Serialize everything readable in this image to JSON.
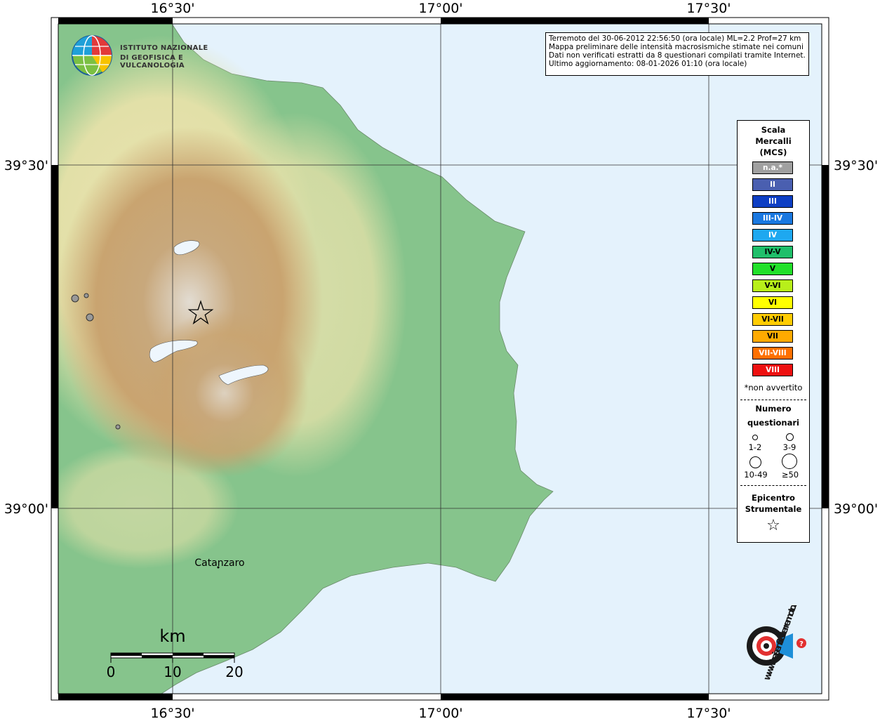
{
  "axes": {
    "lon_labels": [
      "16°30'",
      "17°00'",
      "17°30'"
    ],
    "lat_labels": [
      "39°30'",
      "39°00'"
    ]
  },
  "info_box": {
    "line1": "Terremoto del 30-06-2012 22:56:50 (ora locale) ML=2.2 Prof=27 km",
    "line2": "Mappa preliminare delle intensità macrosismiche stimate nei comuni",
    "line3": "Dati non verificati estratti da 8 questionari compilati tramite Internet.",
    "line4": "Ultimo aggiornamento: 08-01-2026 01:10 (ora locale)"
  },
  "ingv_logo": {
    "line1": "ISTITUTO NAZIONALE",
    "line2": "DI GEOFISICA E VULCANOLOGIA"
  },
  "legend": {
    "title": [
      "Scala",
      "Mercalli",
      "(MCS)"
    ],
    "scale": [
      {
        "label": "n.a.*",
        "color": "#a0a0a0",
        "text_color": "#ffffff"
      },
      {
        "label": "II",
        "color": "#4a5fb0",
        "text_color": "#ffffff"
      },
      {
        "label": "III",
        "color": "#0d3ec4",
        "text_color": "#ffffff"
      },
      {
        "label": "III-IV",
        "color": "#1a78e0",
        "text_color": "#ffffff"
      },
      {
        "label": "IV",
        "color": "#1ea8f0",
        "text_color": "#ffffff"
      },
      {
        "label": "IV-V",
        "color": "#1fbf6a",
        "text_color": "#000000"
      },
      {
        "label": "V",
        "color": "#22e02a",
        "text_color": "#000000"
      },
      {
        "label": "V-VI",
        "color": "#b8ef1a",
        "text_color": "#000000"
      },
      {
        "label": "VI",
        "color": "#ffff00",
        "text_color": "#000000"
      },
      {
        "label": "VI-VII",
        "color": "#ffcc00",
        "text_color": "#000000"
      },
      {
        "label": "VII",
        "color": "#ffaa00",
        "text_color": "#000000"
      },
      {
        "label": "VII-VIII",
        "color": "#ff7000",
        "text_color": "#ffffff"
      },
      {
        "label": "VIII",
        "color": "#ee1010",
        "text_color": "#ffffff"
      }
    ],
    "footnote": "*non avvertito",
    "questionari_title": [
      "Numero",
      "questionari"
    ],
    "sizes": [
      "1-2",
      "3-9",
      "10-49",
      "≥50"
    ],
    "epicentro_title": [
      "Epicentro",
      "Strumentale"
    ],
    "epicentro_symbol": "☆"
  },
  "map": {
    "city": "Catanzaro",
    "epicenter_symbol": "☆",
    "scale_bar": {
      "unit": "km",
      "ticks": [
        "0",
        "10",
        "20"
      ]
    }
  },
  "hsi_logo": {
    "text": "www.haisentitoilterremoto.it"
  },
  "colors": {
    "sea": "#e4f2fc",
    "lowland": "#7fc08a",
    "hills": "#e8e0a6",
    "mountains": "#b89060",
    "peaks": "#dcd6cc",
    "lake": "#eef6fd"
  }
}
